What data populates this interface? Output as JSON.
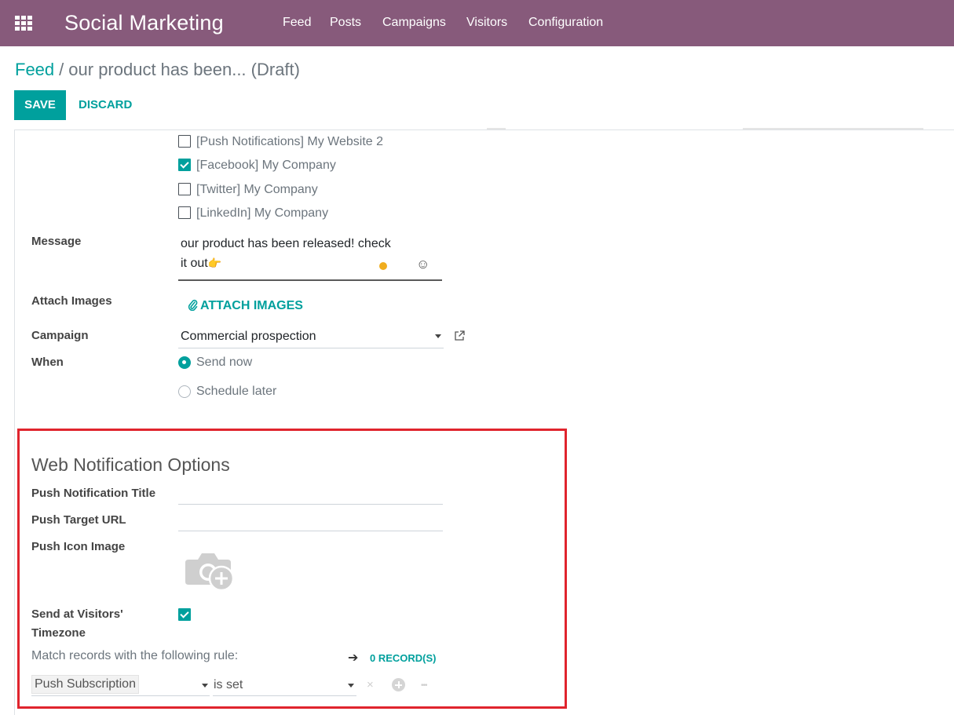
{
  "navbar": {
    "app_name": "Social Marketing",
    "menu": [
      "Feed",
      "Posts",
      "Campaigns",
      "Visitors",
      "Configuration"
    ],
    "bg_color": "#875a7b",
    "apps_icon": "grid-icon"
  },
  "breadcrumb": {
    "parent": "Feed",
    "separator": "/",
    "current": "our product has been... (Draft)"
  },
  "actions": {
    "save": "SAVE",
    "discard": "DISCARD",
    "accent_color": "#00a09d"
  },
  "accounts": [
    {
      "label": "[Push Notifications] My Website 2",
      "checked": false
    },
    {
      "label": "[Facebook] My Company",
      "checked": true
    },
    {
      "label": "[Twitter] My Company",
      "checked": false
    },
    {
      "label": "[LinkedIn] My Company",
      "checked": false
    }
  ],
  "form": {
    "message_label": "Message",
    "message_line1": "our product has been released! check",
    "message_line2": "it out",
    "message_emoji": "👉",
    "smiley_icon": "☺",
    "attach_label": "Attach Images",
    "attach_link": "ATTACH IMAGES",
    "attach_icon": "paperclip-icon",
    "campaign_label": "Campaign",
    "campaign_value": "Commercial prospection",
    "when_label": "When",
    "when_options": [
      {
        "label": "Send now",
        "selected": true
      },
      {
        "label": "Schedule later",
        "selected": false
      }
    ]
  },
  "web_notification": {
    "title": "Web Notification Options",
    "push_title_label": "Push Notification Title",
    "push_url_label": "Push Target URL",
    "push_icon_label": "Push Icon Image",
    "visitor_tz_label_1": "Send at Visitors'",
    "visitor_tz_label_2": "Timezone",
    "visitor_tz_checked": true,
    "rule_text": "Match records with the following rule:",
    "arrow": "➔",
    "records_link": "0 RECORD(S)",
    "domain_field": "Push Subscription",
    "domain_operator": "is set",
    "delete_glyph": "×",
    "more_glyph": "•••",
    "highlight_color": "#e0242d"
  }
}
